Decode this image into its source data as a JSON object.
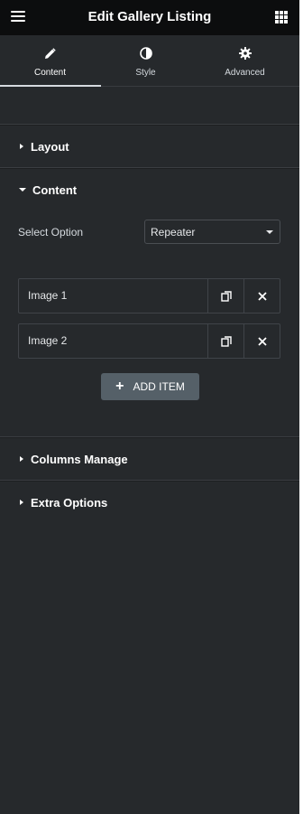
{
  "header": {
    "title": "Edit Gallery Listing",
    "menu_icon": "hamburger-menu-icon",
    "apps_icon": "grid-apps-icon"
  },
  "tabs": [
    {
      "label": "Content",
      "icon": "pencil-icon",
      "active": true
    },
    {
      "label": "Style",
      "icon": "contrast-half-circle-icon",
      "active": false
    },
    {
      "label": "Advanced",
      "icon": "gear-icon",
      "active": false
    }
  ],
  "sections": {
    "layout": {
      "label": "Layout",
      "expanded": false
    },
    "content": {
      "label": "Content",
      "expanded": true
    },
    "columns_manage": {
      "label": "Columns Manage",
      "expanded": false
    },
    "extra_options": {
      "label": "Extra Options",
      "expanded": false
    }
  },
  "content": {
    "select_option_label": "Select Option",
    "select_option_value": "Repeater",
    "repeater_items": [
      {
        "label": "Image 1"
      },
      {
        "label": "Image 2"
      }
    ],
    "add_item_label": "ADD ITEM"
  },
  "colors": {
    "panel_bg": "#26292c",
    "header_bg": "#0c0d0e",
    "add_button_bg": "#556068",
    "text": "#d5dadf"
  }
}
